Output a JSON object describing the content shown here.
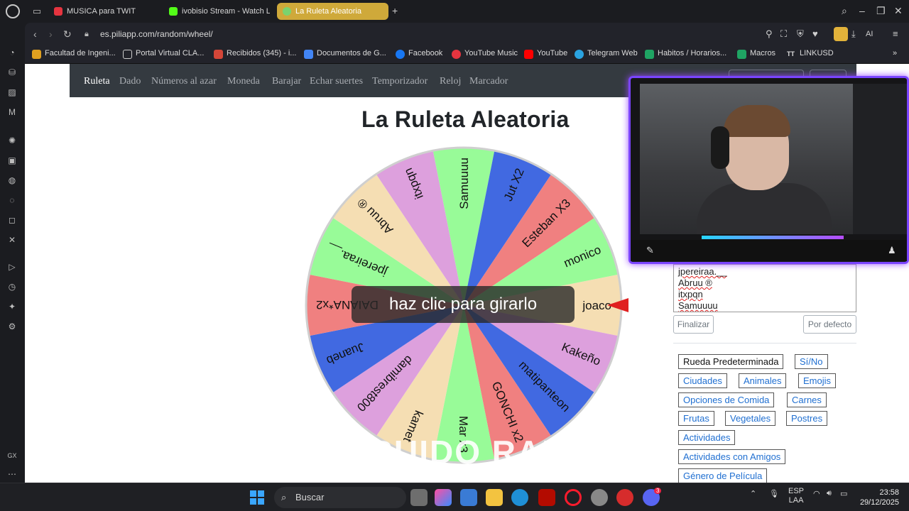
{
  "browser": {
    "tabs": [
      {
        "label": "MUSICA para TWIT",
        "active": false
      },
      {
        "label": "ivobisio Stream - Watch L",
        "active": false
      },
      {
        "label": "La Ruleta Aleatoria",
        "active": true
      }
    ],
    "url": "es.piliapp.com/random/wheel/",
    "ai_label": "AI",
    "bookmarks": [
      "Facultad de Ingeni...",
      "Portal Virtual CLA...",
      "Recibidos (345) - i...",
      "Documentos de G...",
      "Facebook",
      "YouTube Music",
      "YouTube",
      "Telegram Web",
      "Habitos / Horarios...",
      "Macros",
      "LINKUSD"
    ]
  },
  "site": {
    "nav": [
      "Ruleta",
      "Dado",
      "Números al azar",
      "Moneda",
      "Barajar",
      "Echar suertes",
      "Temporizador",
      "Reloj",
      "Marcador"
    ],
    "title": "La Ruleta Aleatoria",
    "spin_hint": "haz clic para girarlo",
    "entries_text": [
      "jpereiraa.__",
      "Abruu ®",
      "itxpqn",
      "Samuuuu"
    ],
    "finalize_label": "Finalizar",
    "default_label": "Por defecto",
    "presets": [
      "Rueda Predeterminada",
      "Sí/No",
      "Ciudades",
      "Animales",
      "Emojis",
      "Opciones de Comida",
      "Carnes",
      "Frutas",
      "Vegetales",
      "Postres",
      "Actividades",
      "Actividades con Amigos",
      "Género de Película"
    ],
    "watermark": "WHEEL OF - RUIDO RANDOM"
  },
  "wheel": {
    "segments": [
      {
        "label": "joaco",
        "color": "#f5deb3"
      },
      {
        "label": "Kakeño",
        "color": "#dda0dd"
      },
      {
        "label": "matipanteon",
        "color": "#4169e1"
      },
      {
        "label": "GONCHI x2",
        "color": "#f08080"
      },
      {
        "label": "Mar x3",
        "color": "#98fb98"
      },
      {
        "label": "kamet",
        "color": "#f5deb3"
      },
      {
        "label": "damibrest800",
        "color": "#dda0dd"
      },
      {
        "label": "Juaneb",
        "color": "#4169e1"
      },
      {
        "label": "DAIANA*x2",
        "color": "#f08080"
      },
      {
        "label": "jpereiraa.__",
        "color": "#98fb98"
      },
      {
        "label": "Abruu ®",
        "color": "#f5deb3"
      },
      {
        "label": "itxpqn",
        "color": "#dda0dd"
      },
      {
        "label": "Samuuuu",
        "color": "#98fb98"
      },
      {
        "label": "Jut X2",
        "color": "#4169e1"
      },
      {
        "label": "Esteban X3",
        "color": "#f08080"
      },
      {
        "label": "monico",
        "color": "#98fb98"
      }
    ],
    "pointer_color": "#e02020"
  },
  "taskbar": {
    "search_label": "Buscar",
    "lang": "ESP",
    "region": "LAA",
    "time": "23:58",
    "date": "29/12/2025",
    "discord_badge": "3"
  }
}
